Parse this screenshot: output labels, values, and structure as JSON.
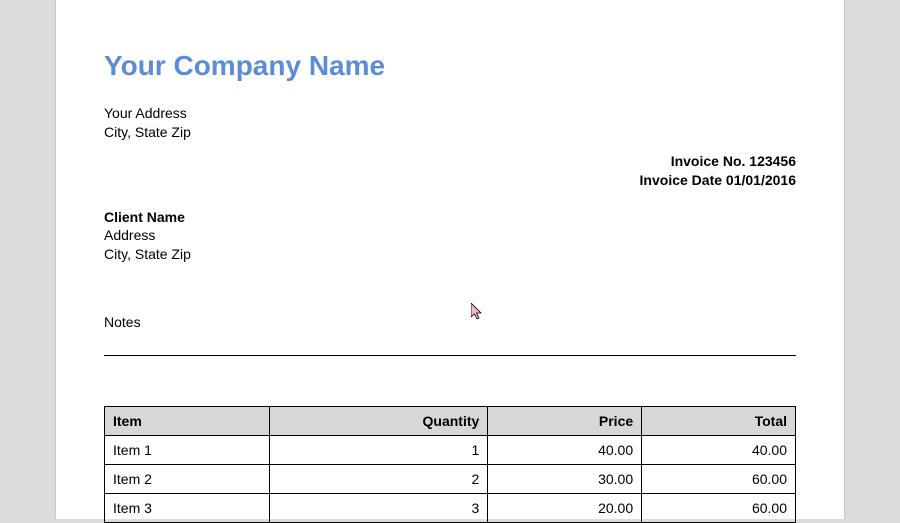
{
  "company": {
    "name": "Your Company Name",
    "address_line1": "Your Address",
    "address_line2": "City, State Zip"
  },
  "invoice": {
    "number_label": "Invoice No.",
    "number": "123456",
    "date_label": "Invoice Date",
    "date": "01/01/2016"
  },
  "client": {
    "name": "Client Name",
    "address_line1": "Address",
    "address_line2": "City, State Zip"
  },
  "notes_label": "Notes",
  "table": {
    "headers": {
      "item": "Item",
      "quantity": "Quantity",
      "price": "Price",
      "total": "Total"
    },
    "rows": [
      {
        "item": "Item 1",
        "quantity": "1",
        "price": "40.00",
        "total": "40.00"
      },
      {
        "item": "Item 2",
        "quantity": "2",
        "price": "30.00",
        "total": "60.00"
      },
      {
        "item": "Item 3",
        "quantity": "3",
        "price": "20.00",
        "total": "60.00"
      }
    ]
  }
}
